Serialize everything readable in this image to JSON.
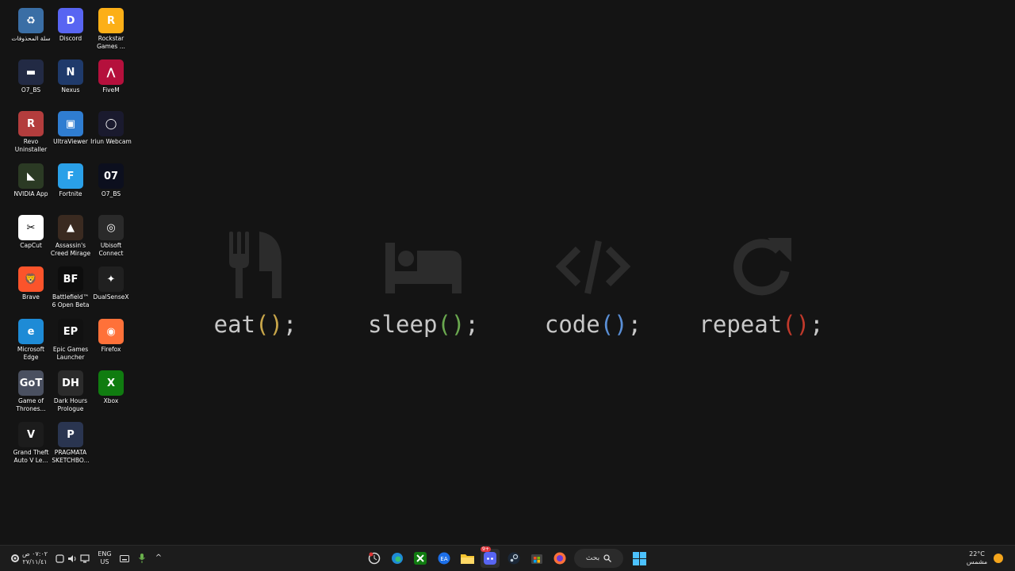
{
  "desktop_icons": [
    {
      "label": "سلة المحذوفات",
      "icon": "recycle-bin-icon",
      "color": "#3a6ea5"
    },
    {
      "label": "Discord",
      "icon": "discord-icon",
      "color": "#5865f2"
    },
    {
      "label": "Rockstar Games ...",
      "icon": "rockstar-icon",
      "color": "#fcaf17"
    },
    {
      "label": "O7_BS",
      "icon": "o7bs-icon",
      "color": "#222a44"
    },
    {
      "label": "Nexus",
      "icon": "nexus-icon",
      "color": "#1f3a6b"
    },
    {
      "label": "FiveM",
      "icon": "fivem-icon",
      "color": "#b5103c"
    },
    {
      "label": "Revo Uninstaller",
      "icon": "revo-icon",
      "color": "#b33d3d"
    },
    {
      "label": "UltraViewer",
      "icon": "ultraviewer-icon",
      "color": "#2f7dd1"
    },
    {
      "label": "Iriun Webcam",
      "icon": "iriun-icon",
      "color": "#1a1a2e"
    },
    {
      "label": "NVIDIA App",
      "icon": "nvidia-icon",
      "color": "#2b3a24"
    },
    {
      "label": "Fortnite",
      "icon": "fortnite-icon",
      "color": "#2aa0e8"
    },
    {
      "label": "O7_BS",
      "icon": "o7bs-icon",
      "color": "#0c0f1e"
    },
    {
      "label": "CapCut",
      "icon": "capcut-icon",
      "color": "#ffffff"
    },
    {
      "label": "Assassin's Creed Mirage",
      "icon": "acmirage-icon",
      "color": "#3a2a20"
    },
    {
      "label": "Ubisoft Connect",
      "icon": "ubisoft-icon",
      "color": "#2a2a2a"
    },
    {
      "label": "Brave",
      "icon": "brave-icon",
      "color": "#fb542b"
    },
    {
      "label": "Battlefield™ 6 Open Beta",
      "icon": "battlefield-icon",
      "color": "#0d0d0d"
    },
    {
      "label": "DualSenseX",
      "icon": "dualsensex-icon",
      "color": "#202020"
    },
    {
      "label": "Microsoft Edge",
      "icon": "edge-icon",
      "color": "#1e8bd6"
    },
    {
      "label": "Epic Games Launcher",
      "icon": "epic-icon",
      "color": "#111111"
    },
    {
      "label": "Firefox",
      "icon": "firefox-icon",
      "color": "#ff7139"
    },
    {
      "label": "Game of Thrones...",
      "icon": "got-icon",
      "color": "#4a5060"
    },
    {
      "label": "Dark Hours Prologue",
      "icon": "darkhours-icon",
      "color": "#2b2b2b"
    },
    {
      "label": "Xbox",
      "icon": "xbox-icon",
      "color": "#107c10"
    },
    {
      "label": "Grand Theft Auto V Le...",
      "icon": "gta-icon",
      "color": "#1c1c1c"
    },
    {
      "label": "PRAGMATA SKETCHBO...",
      "icon": "pragmata-icon",
      "color": "#2a3550"
    }
  ],
  "icon_glyphs": [
    "♻",
    "D",
    "R",
    "▬",
    "N",
    "⋀",
    "R",
    "▣",
    "◯",
    "◣",
    "F",
    "07",
    "✂",
    "▲",
    "◎",
    "🦁",
    "BF",
    "✦",
    "e",
    "EP",
    "◉",
    "GoT",
    "DH",
    "X",
    "V",
    "P"
  ],
  "wallpaper": {
    "eat": "eat",
    "sleep": "sleep",
    "code": "code",
    "repeat": "repeat",
    "parens": "()",
    "semicolon": ";"
  },
  "taskbar": {
    "time": "٠٧:٠٢ ص",
    "date": "٢٧/١١/٤١",
    "lang_top": "ENG",
    "lang_bottom": "US",
    "search_label": "بحث",
    "weather_temp": "22°C",
    "weather_desc": "مشمس",
    "discord_badge": "9+",
    "tray_chevron": "^"
  }
}
